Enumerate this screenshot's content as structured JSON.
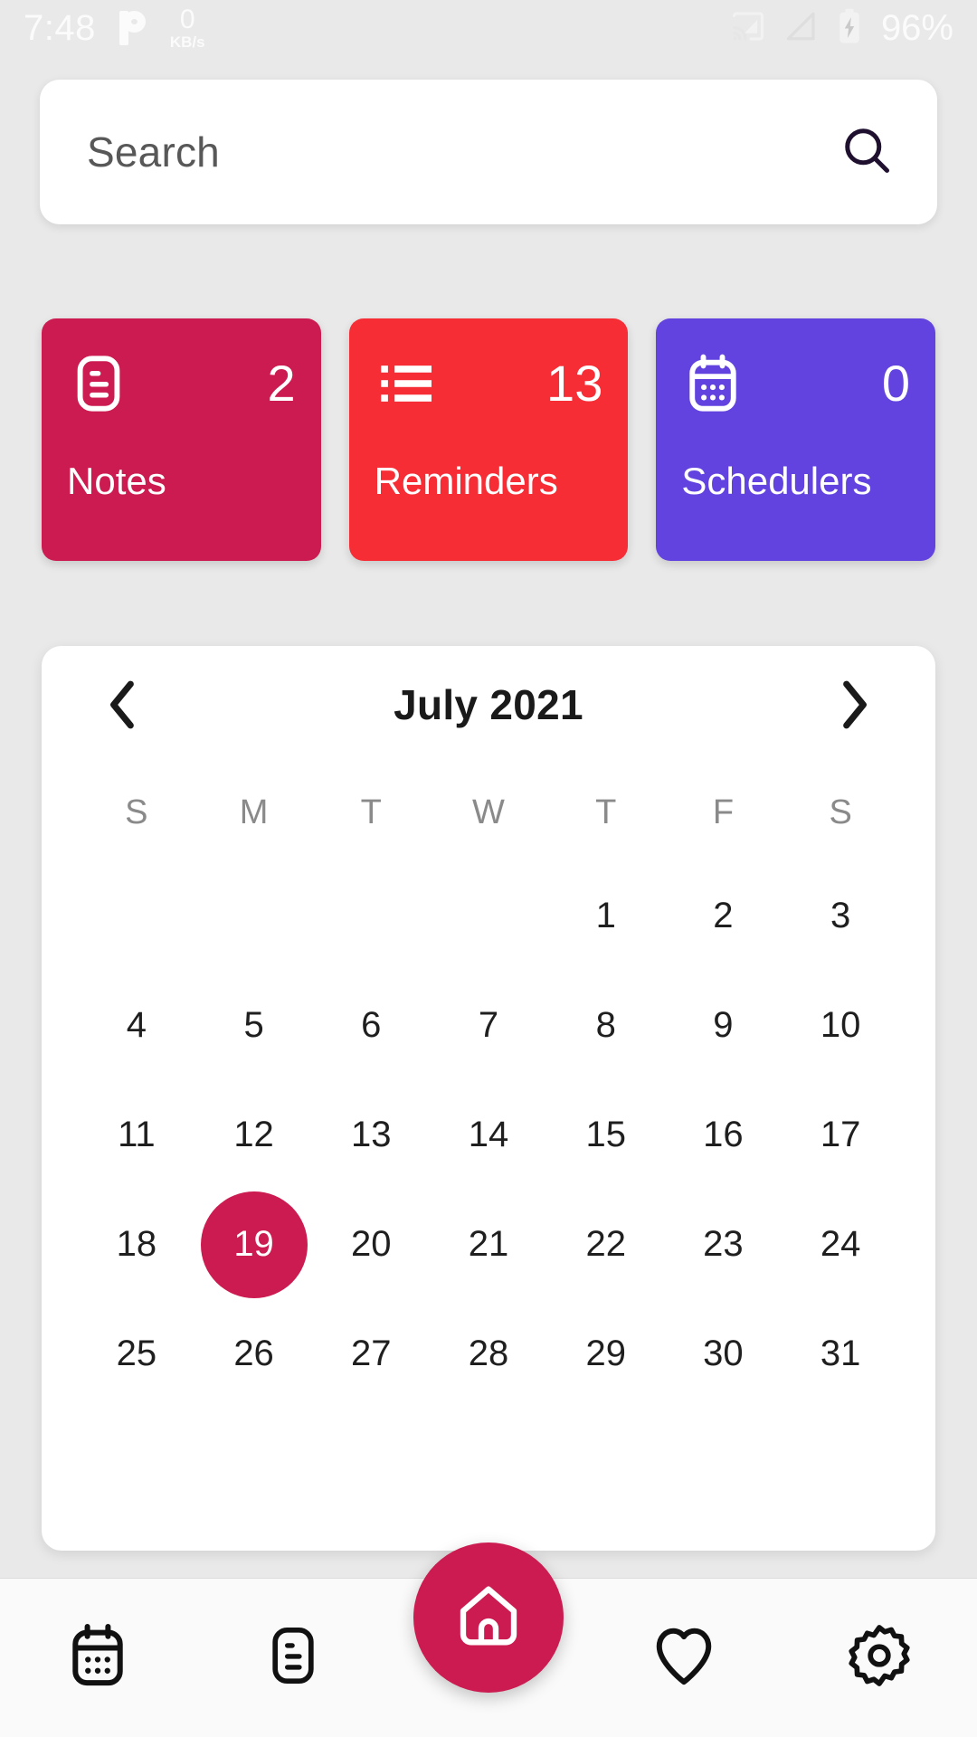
{
  "status_bar": {
    "clock": "7:48",
    "p_icon": "pandora-icon",
    "net_speed_value": "0",
    "net_speed_unit": "KB/s",
    "cast_icon": "cast-icon",
    "signal_icon": "cell-signal-icon",
    "battery_icon": "battery-charging-icon",
    "battery_percent": "96%",
    "text_color": "#fbfbfb"
  },
  "search": {
    "placeholder": "Search",
    "value": "Search",
    "icon": "search-icon"
  },
  "cards": [
    {
      "label": "Notes",
      "count": "2",
      "color": "#cc1b50",
      "icon": "note-document-icon"
    },
    {
      "label": "Reminders",
      "count": "13",
      "color": "#f72d36",
      "icon": "bullet-list-icon"
    },
    {
      "label": "Schedulers",
      "count": "0",
      "color": "#6243e0",
      "icon": "calendar-icon"
    }
  ],
  "calendar": {
    "title": "July 2021",
    "prev_label": "Previous month",
    "next_label": "Next month",
    "weekdays": [
      "S",
      "M",
      "T",
      "W",
      "T",
      "F",
      "S"
    ],
    "leading_blanks": 4,
    "days": [
      "1",
      "2",
      "3",
      "4",
      "5",
      "6",
      "7",
      "8",
      "9",
      "10",
      "11",
      "12",
      "13",
      "14",
      "15",
      "16",
      "17",
      "18",
      "19",
      "20",
      "21",
      "22",
      "23",
      "24",
      "25",
      "26",
      "27",
      "28",
      "29",
      "30",
      "31"
    ],
    "selected_day": "19",
    "selected_color": "#cc1b50",
    "weekday_color": "#8a8a8a",
    "day_color": "#1f1f1f"
  },
  "bottom_nav": {
    "items": [
      {
        "name": "calendar",
        "icon": "calendar-icon"
      },
      {
        "name": "notes",
        "icon": "note-document-icon"
      },
      {
        "name": "home",
        "icon": "home-icon"
      },
      {
        "name": "favorites",
        "icon": "heart-icon"
      },
      {
        "name": "settings",
        "icon": "gear-icon"
      }
    ],
    "fab_color": "#cc1b50"
  },
  "theme": {
    "background": "#e9e9e9",
    "card_surface": "#ffffff",
    "accent": "#cc1b50"
  }
}
